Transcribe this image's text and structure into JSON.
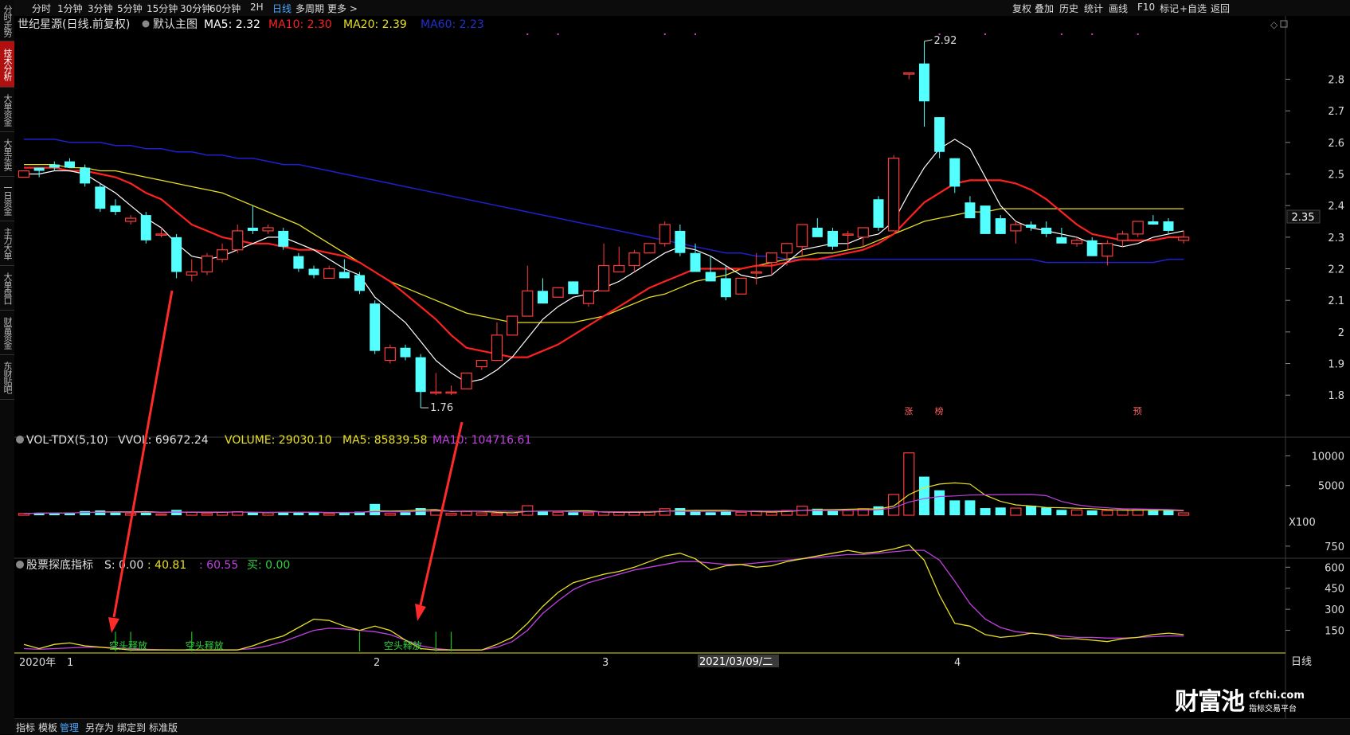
{
  "sidebar": {
    "items": [
      {
        "label": "分时走势"
      },
      {
        "label": "技术分析",
        "active": true
      },
      {
        "label": "大单资金"
      },
      {
        "label": "大单买卖"
      },
      {
        "label": "一日资金"
      },
      {
        "label": "主力大单"
      },
      {
        "label": "大单盘口"
      },
      {
        "label": "财富资金"
      },
      {
        "label": "东财贴吧"
      }
    ]
  },
  "toolbar": {
    "periods": [
      "分时",
      "1分钟",
      "3分钟",
      "5分钟",
      "15分钟",
      "30分钟",
      "60分钟",
      "2H",
      "日线",
      "多周期",
      "更多 >"
    ],
    "active_period": "日线",
    "right_tools": [
      "复权",
      "叠加",
      "历史",
      "统计",
      "画线",
      "F10",
      "标记",
      "+自选",
      "返回"
    ]
  },
  "main_legend": {
    "stock": "世纪星源(日线.前复权)",
    "template": "默认主图",
    "ma5": "MA5: 2.32",
    "ma10": "MA10: 2.30",
    "ma20": "MA20: 2.39",
    "ma60": "MA60: 2.23"
  },
  "vol_legend": {
    "name": "VOL-TDX(5,10)",
    "vvol": "VVOL: 69672.24",
    "volume": "VOLUME: 29030.10",
    "ma5": "MA5: 85839.58",
    "ma10": "MA10: 104716.61"
  },
  "ind_legend": {
    "name": "股票探底指标",
    "s": "S: 0.00",
    "v1": ": 40.81",
    "v2": ": 60.55",
    "buy": "买: 0.00"
  },
  "annotations": {
    "high": "2.92",
    "low": "1.76",
    "signal": "空头释放",
    "markers": [
      "涨",
      "榜",
      "预"
    ],
    "current_price": "2.35",
    "vol_unit": "X100",
    "period_label": "日线",
    "crosshair_date": "2021/03/09/二"
  },
  "x_axis": {
    "labels": [
      "2020年",
      "1",
      "2",
      "3",
      "4"
    ]
  },
  "bottom_tabs": [
    "指标",
    "模板",
    "管理",
    "另存为",
    "绑定到",
    "标准版"
  ],
  "active_bottom_tab": "管理",
  "watermark": {
    "brand": "财富池",
    "url": "cfchi.com",
    "slogan": "指标交易平台"
  },
  "colors": {
    "up": "#ff3b3b",
    "down": "#54ffff",
    "ma5": "#ffffff",
    "ma10": "#ff2020",
    "ma20": "#e8e020",
    "ma60": "#2020d0",
    "purple": "#c040e0",
    "arrow": "#ff2a2a"
  },
  "chart_data": {
    "type": "candlestick",
    "price_axis": {
      "ylim": [
        1.74,
        2.95
      ],
      "ticks": [
        2.8,
        2.7,
        2.6,
        2.5,
        2.4,
        2.3,
        2.2,
        2.1,
        2.0,
        1.9,
        1.8
      ]
    },
    "vol_axis": {
      "ylim": [
        0,
        11000
      ],
      "ticks": [
        10000,
        5000
      ]
    },
    "ind_axis": {
      "ylim": [
        0,
        840
      ],
      "ticks": [
        750.0,
        600.0,
        450.0,
        300.0,
        150.0
      ]
    },
    "candles": [
      [
        2.49,
        2.51,
        2.49,
        2.51
      ],
      [
        2.52,
        2.52,
        2.49,
        2.51
      ],
      [
        2.53,
        2.54,
        2.51,
        2.52
      ],
      [
        2.54,
        2.55,
        2.52,
        2.52
      ],
      [
        2.52,
        2.53,
        2.46,
        2.47
      ],
      [
        2.46,
        2.47,
        2.38,
        2.39
      ],
      [
        2.4,
        2.42,
        2.37,
        2.38
      ],
      [
        2.35,
        2.37,
        2.34,
        2.36
      ],
      [
        2.37,
        2.38,
        2.28,
        2.29
      ],
      [
        2.31,
        2.33,
        2.3,
        2.31
      ],
      [
        2.3,
        2.31,
        2.17,
        2.19
      ],
      [
        2.18,
        2.23,
        2.16,
        2.19
      ],
      [
        2.19,
        2.25,
        2.18,
        2.24
      ],
      [
        2.23,
        2.28,
        2.22,
        2.26
      ],
      [
        2.26,
        2.34,
        2.25,
        2.32
      ],
      [
        2.33,
        2.4,
        2.31,
        2.32
      ],
      [
        2.32,
        2.34,
        2.31,
        2.33
      ],
      [
        2.32,
        2.33,
        2.26,
        2.27
      ],
      [
        2.24,
        2.25,
        2.19,
        2.2
      ],
      [
        2.2,
        2.21,
        2.17,
        2.18
      ],
      [
        2.17,
        2.21,
        2.17,
        2.2
      ],
      [
        2.19,
        2.23,
        2.17,
        2.17
      ],
      [
        2.18,
        2.19,
        2.12,
        2.13
      ],
      [
        2.09,
        2.1,
        1.93,
        1.94
      ],
      [
        1.91,
        1.96,
        1.9,
        1.95
      ],
      [
        1.95,
        1.96,
        1.91,
        1.92
      ],
      [
        1.92,
        1.93,
        1.76,
        1.81
      ],
      [
        1.81,
        1.87,
        1.8,
        1.81
      ],
      [
        1.81,
        1.83,
        1.8,
        1.81
      ],
      [
        1.82,
        1.87,
        1.82,
        1.87
      ],
      [
        1.89,
        1.91,
        1.88,
        1.91
      ],
      [
        1.91,
        2.03,
        1.91,
        1.99
      ],
      [
        1.99,
        2.05,
        1.99,
        2.05
      ],
      [
        2.05,
        2.21,
        2.05,
        2.13
      ],
      [
        2.13,
        2.17,
        2.09,
        2.09
      ],
      [
        2.11,
        2.14,
        2.11,
        2.14
      ],
      [
        2.16,
        2.16,
        2.12,
        2.12
      ],
      [
        2.09,
        2.13,
        2.08,
        2.13
      ],
      [
        2.13,
        2.28,
        2.13,
        2.21
      ],
      [
        2.19,
        2.27,
        2.19,
        2.21
      ],
      [
        2.21,
        2.26,
        2.19,
        2.25
      ],
      [
        2.25,
        2.28,
        2.25,
        2.28
      ],
      [
        2.28,
        2.35,
        2.27,
        2.34
      ],
      [
        2.32,
        2.34,
        2.24,
        2.25
      ],
      [
        2.25,
        2.28,
        2.19,
        2.19
      ],
      [
        2.19,
        2.24,
        2.16,
        2.16
      ],
      [
        2.17,
        2.21,
        2.1,
        2.11
      ],
      [
        2.12,
        2.17,
        2.12,
        2.17
      ],
      [
        2.19,
        2.25,
        2.15,
        2.19
      ],
      [
        2.22,
        2.24,
        2.18,
        2.25
      ],
      [
        2.25,
        2.28,
        2.21,
        2.28
      ],
      [
        2.27,
        2.34,
        2.24,
        2.34
      ],
      [
        2.33,
        2.36,
        2.31,
        2.3
      ],
      [
        2.32,
        2.33,
        2.26,
        2.27
      ],
      [
        2.31,
        2.32,
        2.26,
        2.31
      ],
      [
        2.3,
        2.3,
        2.27,
        2.33
      ],
      [
        2.42,
        2.43,
        2.32,
        2.33
      ],
      [
        2.32,
        2.56,
        2.32,
        2.55
      ],
      [
        2.82,
        2.82,
        2.8,
        2.82
      ],
      [
        2.85,
        2.92,
        2.65,
        2.73
      ],
      [
        2.68,
        2.68,
        2.55,
        2.57
      ],
      [
        2.55,
        2.55,
        2.44,
        2.46
      ],
      [
        2.41,
        2.43,
        2.36,
        2.36
      ],
      [
        2.4,
        2.4,
        2.32,
        2.31
      ],
      [
        2.36,
        2.37,
        2.31,
        2.31
      ],
      [
        2.32,
        2.35,
        2.28,
        2.34
      ],
      [
        2.34,
        2.35,
        2.32,
        2.33
      ],
      [
        2.33,
        2.35,
        2.3,
        2.31
      ],
      [
        2.3,
        2.33,
        2.29,
        2.28
      ],
      [
        2.28,
        2.3,
        2.27,
        2.29
      ],
      [
        2.29,
        2.3,
        2.24,
        2.24
      ],
      [
        2.24,
        2.29,
        2.21,
        2.28
      ],
      [
        2.29,
        2.32,
        2.27,
        2.31
      ],
      [
        2.31,
        2.35,
        2.3,
        2.35
      ],
      [
        2.35,
        2.37,
        2.34,
        2.34
      ],
      [
        2.35,
        2.36,
        2.31,
        2.32
      ],
      [
        2.29,
        2.32,
        2.28,
        2.3
      ]
    ],
    "ma5_series": [
      2.5,
      2.5,
      2.51,
      2.51,
      2.5,
      2.47,
      2.44,
      2.4,
      2.36,
      2.33,
      2.28,
      2.24,
      2.23,
      2.24,
      2.26,
      2.28,
      2.3,
      2.3,
      2.28,
      2.26,
      2.23,
      2.2,
      2.18,
      2.11,
      2.07,
      2.03,
      1.97,
      1.91,
      1.87,
      1.84,
      1.85,
      1.88,
      1.92,
      1.98,
      2.04,
      2.08,
      2.11,
      2.12,
      2.14,
      2.16,
      2.19,
      2.22,
      2.25,
      2.27,
      2.26,
      2.24,
      2.21,
      2.18,
      2.17,
      2.18,
      2.22,
      2.26,
      2.27,
      2.28,
      2.28,
      2.3,
      2.31,
      2.35,
      2.44,
      2.52,
      2.58,
      2.61,
      2.58,
      2.49,
      2.4,
      2.35,
      2.33,
      2.32,
      2.31,
      2.3,
      2.28,
      2.28,
      2.27,
      2.28,
      2.3,
      2.31,
      2.32
    ],
    "ma10_series": [
      2.52,
      2.52,
      2.52,
      2.51,
      2.51,
      2.5,
      2.49,
      2.47,
      2.44,
      2.42,
      2.38,
      2.34,
      2.32,
      2.3,
      2.29,
      2.28,
      2.28,
      2.27,
      2.26,
      2.26,
      2.25,
      2.24,
      2.22,
      2.19,
      2.16,
      2.12,
      2.08,
      2.04,
      1.99,
      1.95,
      1.94,
      1.93,
      1.92,
      1.92,
      1.94,
      1.96,
      1.99,
      2.02,
      2.05,
      2.08,
      2.11,
      2.14,
      2.16,
      2.18,
      2.2,
      2.2,
      2.2,
      2.2,
      2.21,
      2.21,
      2.22,
      2.23,
      2.23,
      2.24,
      2.25,
      2.26,
      2.28,
      2.31,
      2.36,
      2.41,
      2.44,
      2.47,
      2.48,
      2.48,
      2.48,
      2.47,
      2.45,
      2.42,
      2.38,
      2.34,
      2.31,
      2.3,
      2.29,
      2.29,
      2.29,
      2.3,
      2.3
    ],
    "ma20_series": [
      2.53,
      2.53,
      2.53,
      2.52,
      2.52,
      2.51,
      2.51,
      2.5,
      2.49,
      2.48,
      2.47,
      2.46,
      2.45,
      2.44,
      2.42,
      2.4,
      2.38,
      2.36,
      2.34,
      2.31,
      2.28,
      2.25,
      2.22,
      2.19,
      2.16,
      2.14,
      2.12,
      2.1,
      2.08,
      2.06,
      2.05,
      2.04,
      2.03,
      2.03,
      2.03,
      2.03,
      2.03,
      2.04,
      2.05,
      2.07,
      2.09,
      2.11,
      2.12,
      2.14,
      2.16,
      2.17,
      2.18,
      2.2,
      2.21,
      2.22,
      2.23,
      2.24,
      2.25,
      2.25,
      2.26,
      2.27,
      2.29,
      2.31,
      2.33,
      2.35,
      2.36,
      2.37,
      2.38,
      2.38,
      2.39,
      2.39,
      2.39,
      2.39,
      2.39,
      2.39,
      2.39,
      2.39,
      2.39,
      2.39,
      2.39,
      2.39,
      2.39
    ],
    "ma60_series": [
      2.61,
      2.61,
      2.61,
      2.6,
      2.6,
      2.6,
      2.59,
      2.59,
      2.58,
      2.58,
      2.57,
      2.57,
      2.56,
      2.56,
      2.55,
      2.55,
      2.54,
      2.53,
      2.53,
      2.52,
      2.51,
      2.5,
      2.49,
      2.48,
      2.47,
      2.46,
      2.45,
      2.44,
      2.43,
      2.42,
      2.41,
      2.4,
      2.39,
      2.38,
      2.37,
      2.36,
      2.35,
      2.34,
      2.33,
      2.32,
      2.31,
      2.3,
      2.29,
      2.28,
      2.27,
      2.26,
      2.25,
      2.25,
      2.24,
      2.24,
      2.23,
      2.23,
      2.23,
      2.23,
      2.23,
      2.23,
      2.23,
      2.23,
      2.23,
      2.23,
      2.23,
      2.23,
      2.23,
      2.23,
      2.23,
      2.23,
      2.23,
      2.22,
      2.22,
      2.22,
      2.22,
      2.22,
      2.22,
      2.22,
      2.22,
      2.23,
      2.23
    ],
    "volumes": [
      300,
      400,
      400,
      400,
      700,
      800,
      600,
      300,
      600,
      200,
      900,
      500,
      300,
      500,
      600,
      500,
      400,
      500,
      500,
      500,
      300,
      400,
      600,
      1900,
      300,
      500,
      1200,
      800,
      300,
      600,
      400,
      300,
      400,
      1600,
      700,
      500,
      500,
      400,
      600,
      500,
      500,
      600,
      1100,
      1200,
      700,
      500,
      600,
      500,
      700,
      500,
      800,
      1500,
      1100,
      800,
      800,
      1100,
      1500,
      3500,
      10500,
      6500,
      4200,
      2500,
      2500,
      1200,
      1300,
      1200,
      1600,
      1300,
      900,
      900,
      800,
      800,
      900,
      900,
      800,
      800,
      400
    ],
    "ind_yellow": [
      50,
      20,
      50,
      60,
      40,
      30,
      20,
      10,
      10,
      10,
      10,
      10,
      10,
      10,
      10,
      40,
      80,
      110,
      170,
      230,
      220,
      180,
      150,
      180,
      150,
      80,
      20,
      10,
      10,
      10,
      10,
      50,
      100,
      200,
      320,
      420,
      490,
      520,
      550,
      570,
      600,
      640,
      680,
      700,
      660,
      580,
      610,
      620,
      600,
      610,
      640,
      660,
      680,
      700,
      720,
      700,
      710,
      730,
      760,
      650,
      400,
      200,
      180,
      120,
      100,
      110,
      130,
      120,
      90,
      90,
      80,
      70,
      90,
      100,
      120,
      130,
      120
    ],
    "ind_purple": [
      20,
      15,
      20,
      25,
      30,
      30,
      25,
      20,
      15,
      12,
      10,
      10,
      10,
      10,
      12,
      20,
      40,
      70,
      110,
      150,
      165,
      160,
      150,
      140,
      120,
      80,
      40,
      20,
      10,
      10,
      10,
      30,
      70,
      150,
      270,
      360,
      440,
      490,
      520,
      550,
      580,
      600,
      620,
      640,
      640,
      630,
      620,
      620,
      630,
      640,
      650,
      660,
      670,
      680,
      690,
      690,
      700,
      710,
      720,
      720,
      650,
      500,
      340,
      230,
      170,
      140,
      130,
      120,
      110,
      100,
      100,
      95,
      95,
      100,
      105,
      110,
      110
    ],
    "markers": [
      {
        "label": "涨",
        "index": 58
      },
      {
        "label": "榜",
        "index": 60
      },
      {
        "label": "预",
        "index": 73
      }
    ],
    "signals": [
      {
        "text": "空头释放",
        "index": 6
      },
      {
        "text": "空头释放",
        "index": 11
      },
      {
        "text": "空头释放",
        "index": 24
      }
    ]
  }
}
